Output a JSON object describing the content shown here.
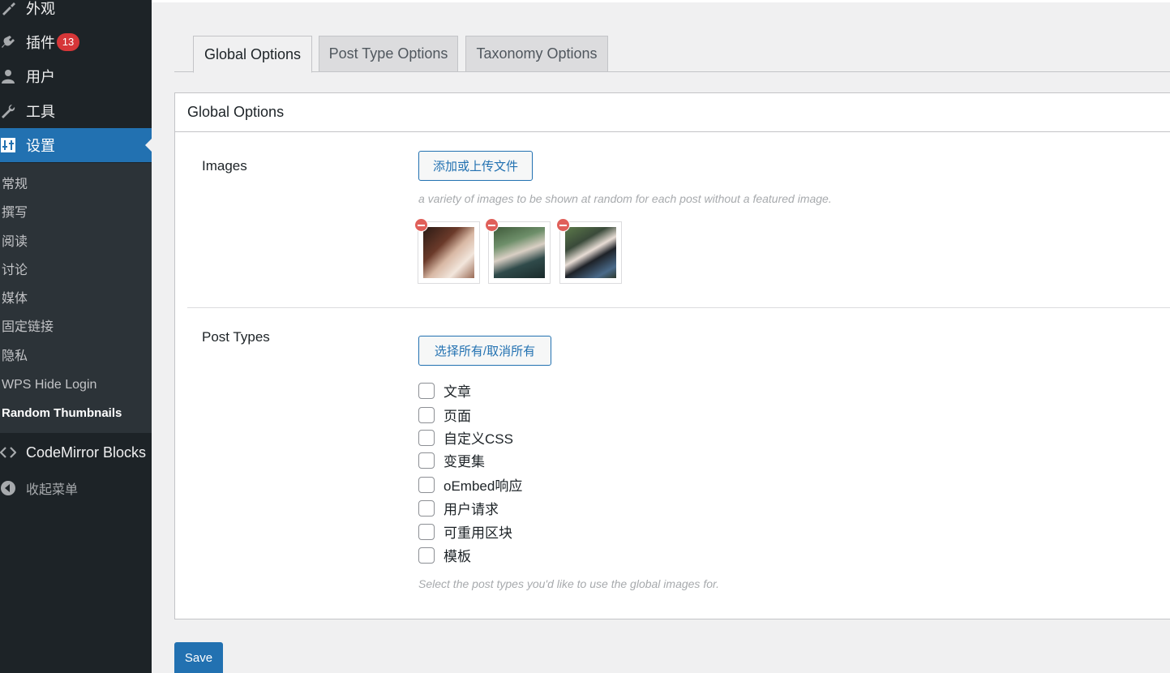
{
  "sidebar": {
    "top_items": [
      {
        "label": "外观",
        "icon": "brush-icon"
      },
      {
        "label": "插件",
        "icon": "plugin-icon",
        "badge": "13"
      },
      {
        "label": "用户",
        "icon": "user-icon"
      },
      {
        "label": "工具",
        "icon": "wrench-icon"
      },
      {
        "label": "设置",
        "icon": "settings-icon"
      }
    ],
    "submenu": [
      "常规",
      "撰写",
      "阅读",
      "讨论",
      "媒体",
      "固定链接",
      "隐私",
      "WPS Hide Login",
      "Random Thumbnails"
    ],
    "extra": {
      "label": "CodeMirror Blocks",
      "icon": "code-icon"
    },
    "collapse": {
      "label": "收起菜单",
      "icon": "collapse-arrow-icon"
    }
  },
  "tabs": [
    "Global Options",
    "Post Type Options",
    "Taxonomy Options"
  ],
  "panel": {
    "title": "Global Options",
    "images": {
      "label": "Images",
      "button": "添加或上传文件",
      "description": "a variety of images to be shown at random for each post without a featured image."
    },
    "post_types": {
      "label": "Post Types",
      "button": "选择所有/取消所有",
      "options": [
        "文章",
        "页面",
        "自定义CSS",
        "变更集",
        "oEmbed响应",
        "用户请求",
        "可重用区块",
        "模板"
      ],
      "description": "Select the post types you'd like to use the global images for."
    }
  },
  "save_label": "Save",
  "colors": {
    "admin_blue": "#2271b1",
    "sidebar_bg": "#1d2327",
    "badge_red": "#d63638"
  }
}
